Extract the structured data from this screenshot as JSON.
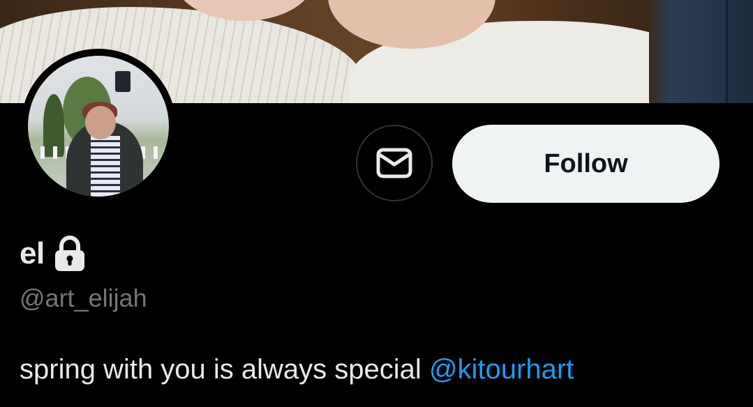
{
  "profile": {
    "display_name": "el",
    "handle": "@art_elijah",
    "bio_text": "spring with you is always special ",
    "bio_mention": "@kitourhart",
    "protected": true
  },
  "actions": {
    "follow_label": "Follow",
    "message_icon": "envelope-icon"
  },
  "colors": {
    "background": "#000000",
    "primary_text": "#e7e9ea",
    "secondary_text": "#71767b",
    "link": "#1d9bf0",
    "follow_button_bg": "#eff3f4",
    "follow_button_text": "#0f1419"
  },
  "icons": {
    "lock": "lock-icon",
    "message": "envelope-icon"
  }
}
